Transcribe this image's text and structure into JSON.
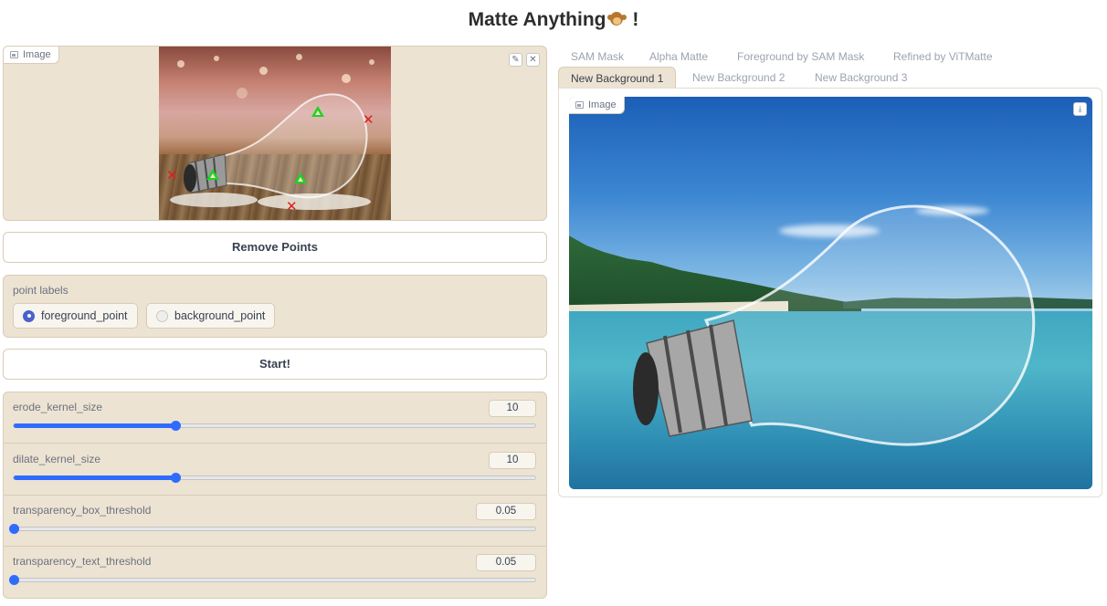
{
  "page": {
    "title": "Matte Anything",
    "title_suffix": "!"
  },
  "input_image": {
    "label": "Image",
    "edit_icon": "pencil-icon",
    "close_icon": "close-icon",
    "markers": {
      "foreground": "triangle-icon",
      "background": "x-icon"
    }
  },
  "buttons": {
    "remove_points": "Remove Points",
    "start": "Start!"
  },
  "point_labels": {
    "label": "point labels",
    "options": [
      "foreground_point",
      "background_point"
    ],
    "selected": "foreground_point"
  },
  "sliders": [
    {
      "label": "erode_kernel_size",
      "value": "10",
      "fraction": 0.31
    },
    {
      "label": "dilate_kernel_size",
      "value": "10",
      "fraction": 0.31
    },
    {
      "label": "transparency_box_threshold",
      "value": "0.05",
      "fraction": 0.0
    },
    {
      "label": "transparency_text_threshold",
      "value": "0.05",
      "fraction": 0.0
    }
  ],
  "tabs": {
    "row1": [
      "SAM Mask",
      "Alpha Matte",
      "Foreground by SAM Mask",
      "Refined by ViTMatte"
    ],
    "row2": [
      "New Background 1",
      "New Background 2",
      "New Background 3"
    ],
    "selected": "New Background 1"
  },
  "output_image": {
    "label": "Image",
    "download_icon": "download-icon"
  },
  "colors": {
    "panel_bg": "#ede3d2",
    "accent": "#2f6bff",
    "radio_selected": "#4a62c9",
    "foreground_marker": "#1fd31f",
    "background_marker": "#e11d1d"
  }
}
